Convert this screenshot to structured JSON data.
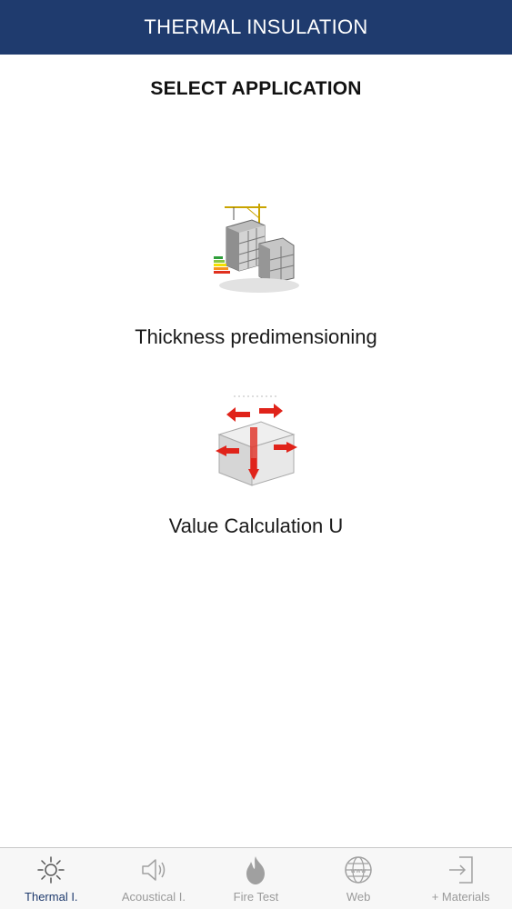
{
  "header": {
    "title": "THERMAL INSULATION",
    "background_color": "#1f3b6e"
  },
  "main": {
    "subtitle": "SELECT APPLICATION",
    "options": [
      {
        "label": "Thickness predimensioning",
        "icon": "building-construction-image"
      },
      {
        "label": "Value Calculation U",
        "icon": "heat-loss-house-image"
      }
    ]
  },
  "tabbar": {
    "active_index": 0,
    "tabs": [
      {
        "label": "Thermal I.",
        "icon": "sun-icon"
      },
      {
        "label": "Acoustical I.",
        "icon": "speaker-icon"
      },
      {
        "label": "Fire Test",
        "icon": "flame-icon"
      },
      {
        "label": "Web",
        "icon": "globe-icon"
      },
      {
        "label": "+ Materials",
        "icon": "sign-in-icon"
      }
    ]
  }
}
